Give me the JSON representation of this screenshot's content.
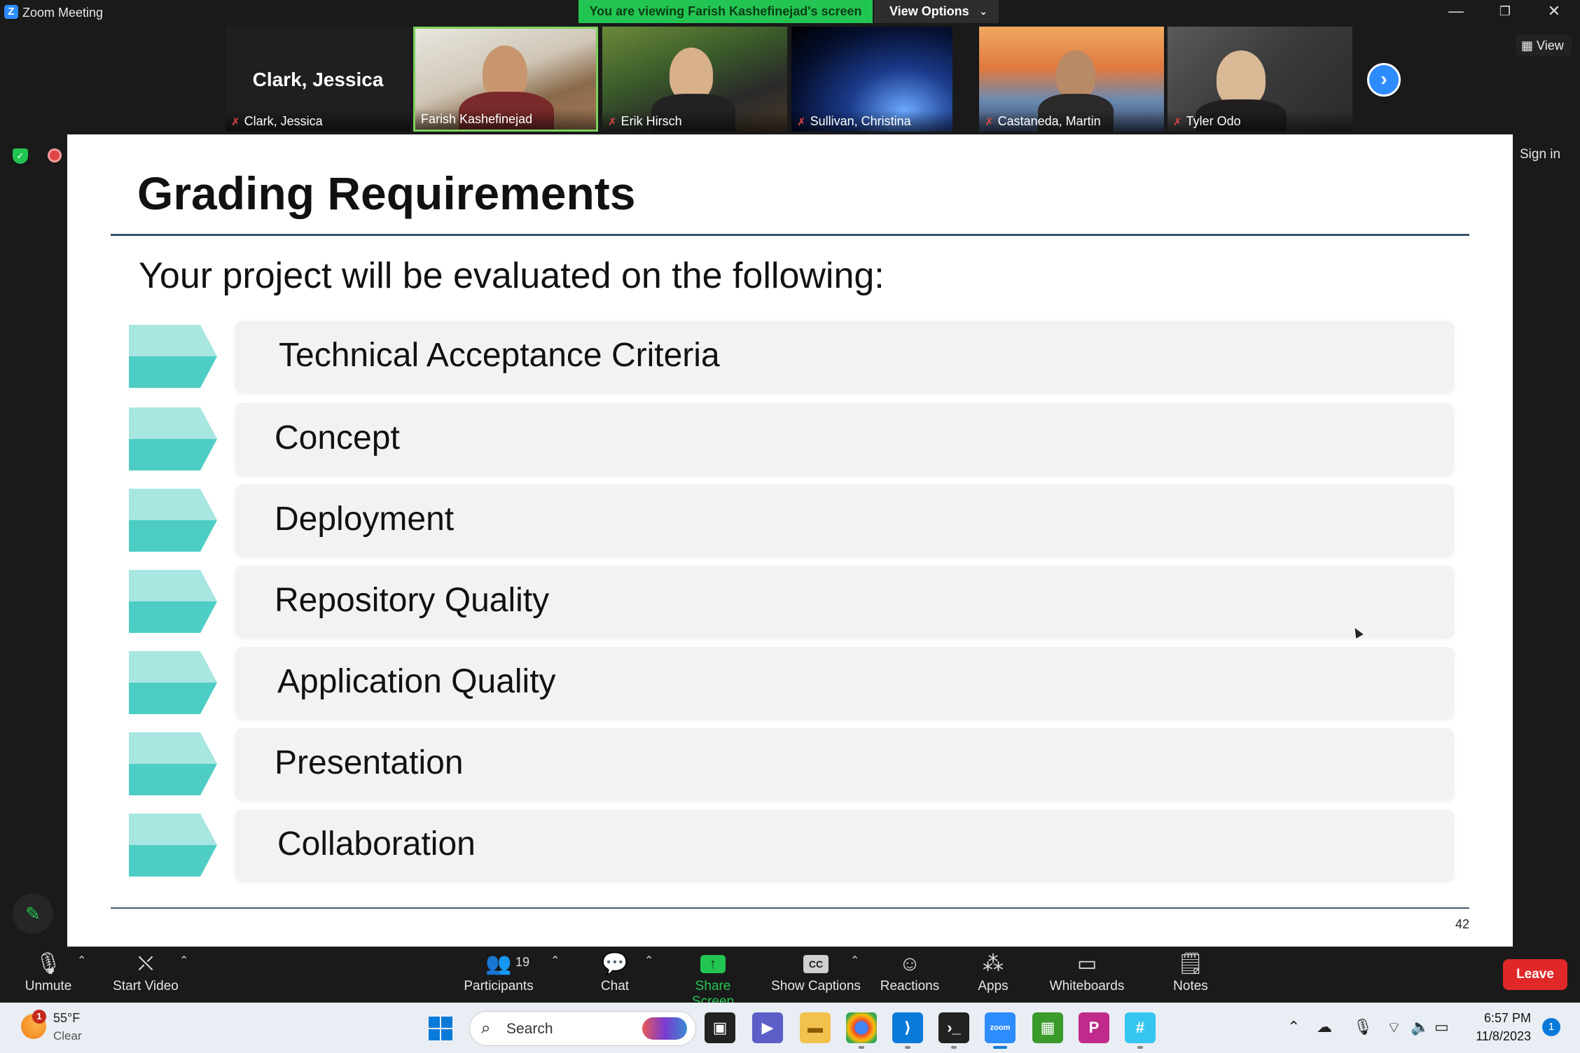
{
  "window": {
    "logo": "Z",
    "title": "Zoom Meeting",
    "viewing_banner": "You are viewing Farish Kashefinejad's screen",
    "view_options": "View Options",
    "minimize": "—",
    "restore": "❐",
    "close": "✕"
  },
  "participants_strip": {
    "tiles": [
      {
        "name": "Clark, Jessica",
        "display": "Clark, Jessica",
        "muted": true
      },
      {
        "name": "Farish Kashefinejad",
        "muted": false,
        "active_speaker": true
      },
      {
        "name": "Erik Hirsch",
        "muted": true
      },
      {
        "name": "Sullivan, Christina",
        "muted": true
      },
      {
        "name": "Castaneda, Martin",
        "muted": true
      },
      {
        "name": "Tyler Odo",
        "muted": true
      }
    ],
    "next_icon": "›",
    "view_label": "View"
  },
  "sign_in": "Sign in",
  "slide": {
    "title": "Grading Requirements",
    "subtitle": "Your project will be evaluated on the following:",
    "items": [
      "Technical Acceptance Criteria",
      "Concept",
      "Deployment",
      "Repository Quality",
      "Application Quality",
      "Presentation",
      "Collaboration"
    ],
    "page_number": "42",
    "chevron_colors": {
      "top": "#a8e6e2",
      "bottom": "#4ecdc4"
    }
  },
  "toolbar": {
    "unmute": "Unmute",
    "start_video": "Start Video",
    "participants": "Participants",
    "participants_count": "19",
    "chat": "Chat",
    "share_screen": "Share Screen",
    "show_captions": "Show Captions",
    "captions_icon": "CC",
    "reactions": "Reactions",
    "apps": "Apps",
    "whiteboards": "Whiteboards",
    "notes": "Notes",
    "leave": "Leave"
  },
  "taskbar": {
    "weather_badge": "1",
    "temperature": "55°F",
    "condition": "Clear",
    "search_placeholder": "Search",
    "time": "6:57 PM",
    "date": "11/8/2023",
    "notifications": "1"
  },
  "colors": {
    "accent_green": "#23c552",
    "zoom_blue": "#2d8cff",
    "leave_red": "#e02828"
  }
}
